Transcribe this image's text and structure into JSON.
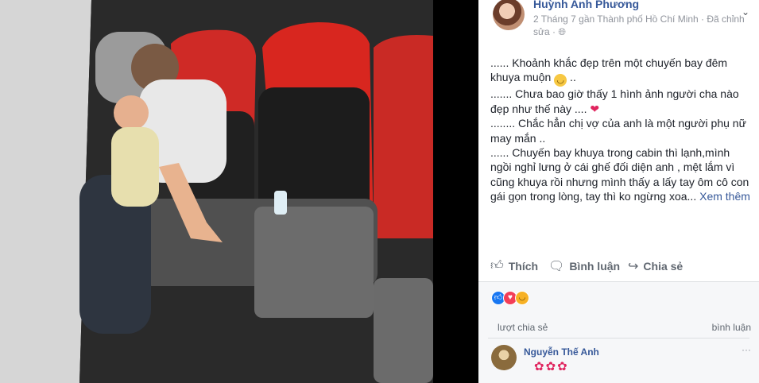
{
  "post": {
    "author": "Huỳnh Anh Phương",
    "meta": "2 Tháng 7 gần Thành phố Hồ Chí Minh · Đã chỉnh sửa · ",
    "privacy_icon": "globe-icon",
    "menu_icon": "chevron-down-icon",
    "paragraphs": [
      "...... Khoảnh khắc đẹp trên một chuyến bay đêm khuya muộn",
      "....... Chưa bao giờ thấy 1 hình ảnh người cha nào đẹp như thế này ....",
      "........ Chắc hẳn chị vợ của anh là một người phụ nữ may mắn ..",
      "...... Chuyến bay khuya trong cabin thì lạnh,mình ngồi nghỉ lưng ở cái ghế đối diện anh , mệt lắm vì cũng khuya rồi nhưng mình thấy a lấy tay ôm cô con gái gọn trong lòng, tay thì ko ngừng xoa..."
    ],
    "emoji_smile": "🙂",
    "emoji_heart": "❤",
    "see_more": "Xem thêm",
    "paragraph_suffix_1": " ..",
    "paragraph_suffix_2": " "
  },
  "actions": {
    "like": "Thích",
    "comment": "Bình luận",
    "share": "Chia sẻ",
    "like_icon": "👍",
    "comment_icon": "💬",
    "share_icon": "↪"
  },
  "stats": {
    "shares_text": "lượt chia sẻ",
    "comments_text": "bình luận"
  },
  "comment": {
    "name": "Nguyễn Thế Anh",
    "sticker": "✿✿✿",
    "menu": "···"
  },
  "colors": {
    "link": "#365899",
    "meta": "#90949c",
    "text": "#1d2129"
  }
}
